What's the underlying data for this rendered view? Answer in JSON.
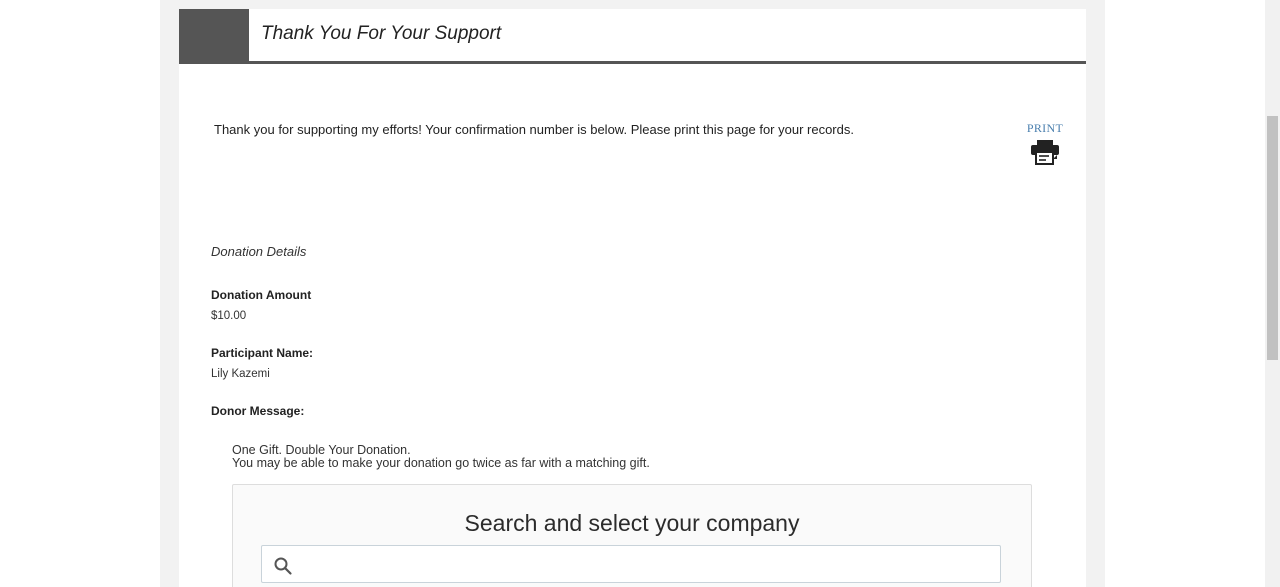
{
  "header": {
    "title": "Thank You For Your Support"
  },
  "intro": {
    "text": "Thank you for supporting my efforts! Your confirmation number is below. Please print this page for your records."
  },
  "print": {
    "label": "PRINT",
    "icon": "printer-icon"
  },
  "details": {
    "heading": "Donation Details",
    "donation_amount_label": "Donation Amount",
    "donation_amount_value": "$10.00",
    "participant_name_label": "Participant Name:",
    "participant_name_value": "Lily Kazemi",
    "donor_message_label": "Donor Message:"
  },
  "matching_gift": {
    "line1": "One Gift. Double Your Donation.",
    "line2": "You may be able to make your donation go twice as far with a matching gift.",
    "search_title": "Search and select your company",
    "search_placeholder": "",
    "search_icon": "search-icon"
  },
  "colors": {
    "header_accent": "#555555",
    "print_link": "#4a7fae",
    "page_background": "#f2f2f2"
  }
}
